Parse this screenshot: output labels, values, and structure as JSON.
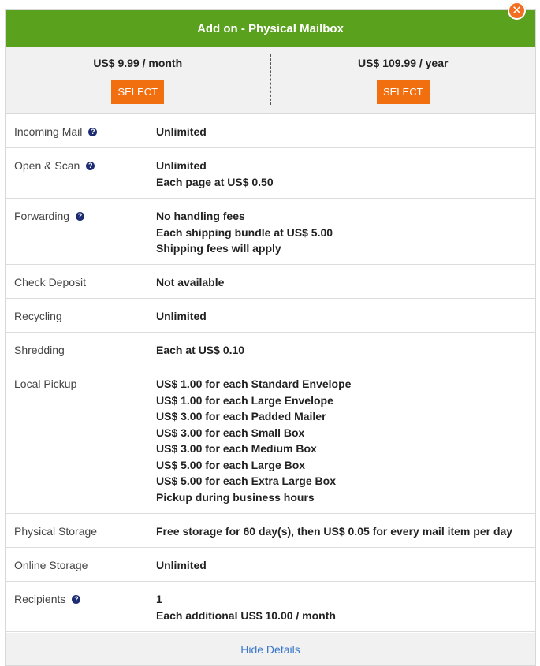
{
  "header": {
    "title": "Add on - Physical Mailbox"
  },
  "close": {
    "glyph": "✕"
  },
  "plans": [
    {
      "price": "US$ 9.99 / month",
      "button": "SELECT"
    },
    {
      "price": "US$ 109.99 / year",
      "button": "SELECT"
    }
  ],
  "rows": [
    {
      "label": "Incoming Mail",
      "help": true,
      "lines": [
        "Unlimited"
      ]
    },
    {
      "label": "Open & Scan",
      "help": true,
      "lines": [
        "Unlimited",
        "Each page at US$ 0.50"
      ]
    },
    {
      "label": "Forwarding",
      "help": true,
      "lines": [
        "No handling fees",
        "Each shipping bundle at US$ 5.00",
        "Shipping fees will apply"
      ]
    },
    {
      "label": "Check Deposit",
      "help": false,
      "lines": [
        "Not available"
      ]
    },
    {
      "label": "Recycling",
      "help": false,
      "lines": [
        "Unlimited"
      ]
    },
    {
      "label": "Shredding",
      "help": false,
      "lines": [
        "Each at US$ 0.10"
      ]
    },
    {
      "label": "Local Pickup",
      "help": false,
      "lines": [
        "US$ 1.00 for each Standard Envelope",
        "US$ 1.00 for each Large Envelope",
        "US$ 3.00 for each Padded Mailer",
        "US$ 3.00 for each Small Box",
        "US$ 3.00 for each Medium Box",
        "US$ 5.00 for each Large Box",
        "US$ 5.00 for each Extra Large Box",
        "Pickup during business hours"
      ]
    },
    {
      "label": "Physical Storage",
      "help": false,
      "lines": [
        "Free storage for 60 day(s), then US$ 0.05 for every mail item per day"
      ]
    },
    {
      "label": "Online Storage",
      "help": false,
      "lines": [
        "Unlimited"
      ]
    },
    {
      "label": "Recipients",
      "help": true,
      "lines": [
        "1",
        "Each additional US$ 10.00 / month"
      ]
    }
  ],
  "footer": {
    "link": "Hide Details"
  },
  "colors": {
    "header": "#5aa21e",
    "button": "#f26f10",
    "link": "#3a77c8",
    "help_icon": "#1d2b73"
  }
}
